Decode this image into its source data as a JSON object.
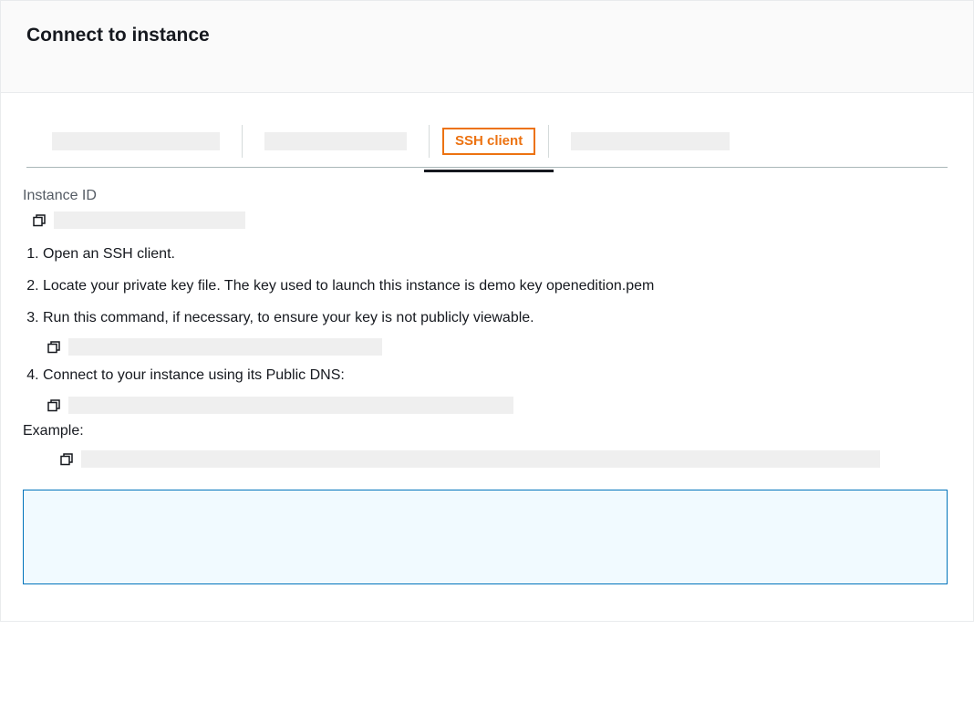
{
  "header": {
    "title": "Connect to instance"
  },
  "tabs": {
    "active_label": "SSH client"
  },
  "instance_id": {
    "label": "Instance ID"
  },
  "steps": {
    "s1": "Open an SSH client.",
    "s2": "Locate your private key file. The key used to launch this instance is demo key openedition.pem",
    "s3": "Run this command, if necessary, to ensure your key is not publicly viewable.",
    "s4": "Connect to your instance using its Public DNS:"
  },
  "example": {
    "label": "Example:"
  }
}
